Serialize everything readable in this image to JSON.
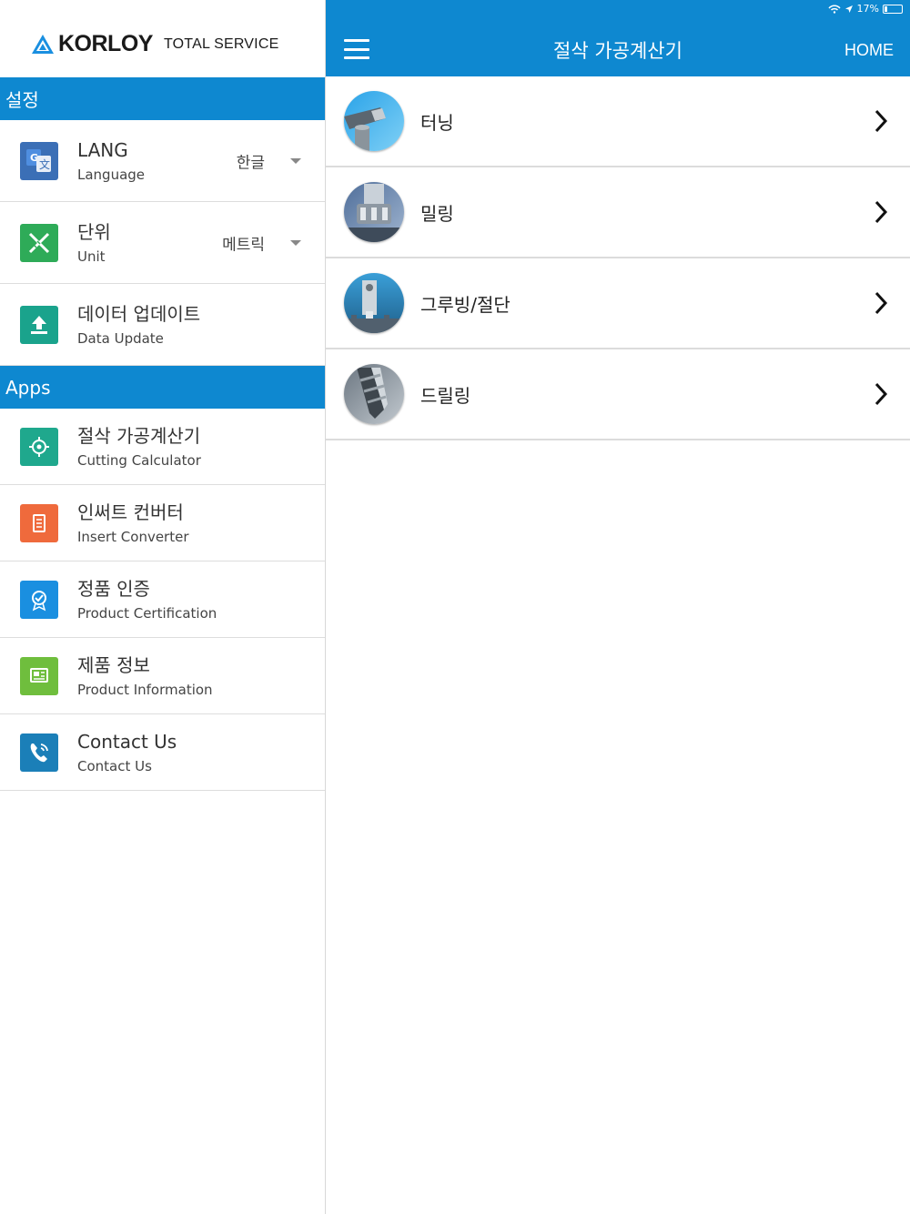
{
  "status": {
    "battery_text": "17%",
    "battery_level": 0.17
  },
  "brand": {
    "name": "KORLOY",
    "tagline": "TOTAL SERVICE"
  },
  "sidebar": {
    "settings_header": "설정",
    "settings": [
      {
        "title": "LANG",
        "subtitle": "Language",
        "value": "한글",
        "icon": "translate-icon",
        "color": "#3b6fb6"
      },
      {
        "title": "단위",
        "subtitle": "Unit",
        "value": "메트릭",
        "icon": "ruler-pencil-icon",
        "color": "#2eab58"
      },
      {
        "title": "데이터 업데이트",
        "subtitle": "Data Update",
        "icon": "upload-icon",
        "color": "#1aa38c"
      }
    ],
    "apps_header": "Apps",
    "apps": [
      {
        "title": "절삭 가공계산기",
        "subtitle": "Cutting Calculator",
        "icon": "calculator-icon",
        "color": "#1fa88d"
      },
      {
        "title": "인써트 컨버터",
        "subtitle": "Insert Converter",
        "icon": "converter-icon",
        "color": "#ef6a3c"
      },
      {
        "title": "정품 인증",
        "subtitle": "Product Certification",
        "icon": "certification-icon",
        "color": "#1a8fe0"
      },
      {
        "title": "제품 정보",
        "subtitle": "Product Information",
        "icon": "info-icon",
        "color": "#6fbe3d"
      },
      {
        "title": "Contact Us",
        "subtitle": "Contact Us",
        "icon": "phone-icon",
        "color": "#1b7fb8"
      }
    ]
  },
  "header": {
    "title": "절삭 가공계산기",
    "home_label": "HOME"
  },
  "categories": [
    {
      "label": "터닝",
      "icon": "turning-icon"
    },
    {
      "label": "밀링",
      "icon": "milling-icon"
    },
    {
      "label": "그루빙/절단",
      "icon": "grooving-icon"
    },
    {
      "label": "드릴링",
      "icon": "drilling-icon"
    }
  ],
  "colors": {
    "accent": "#0e88d0",
    "divider": "#dddddd"
  }
}
